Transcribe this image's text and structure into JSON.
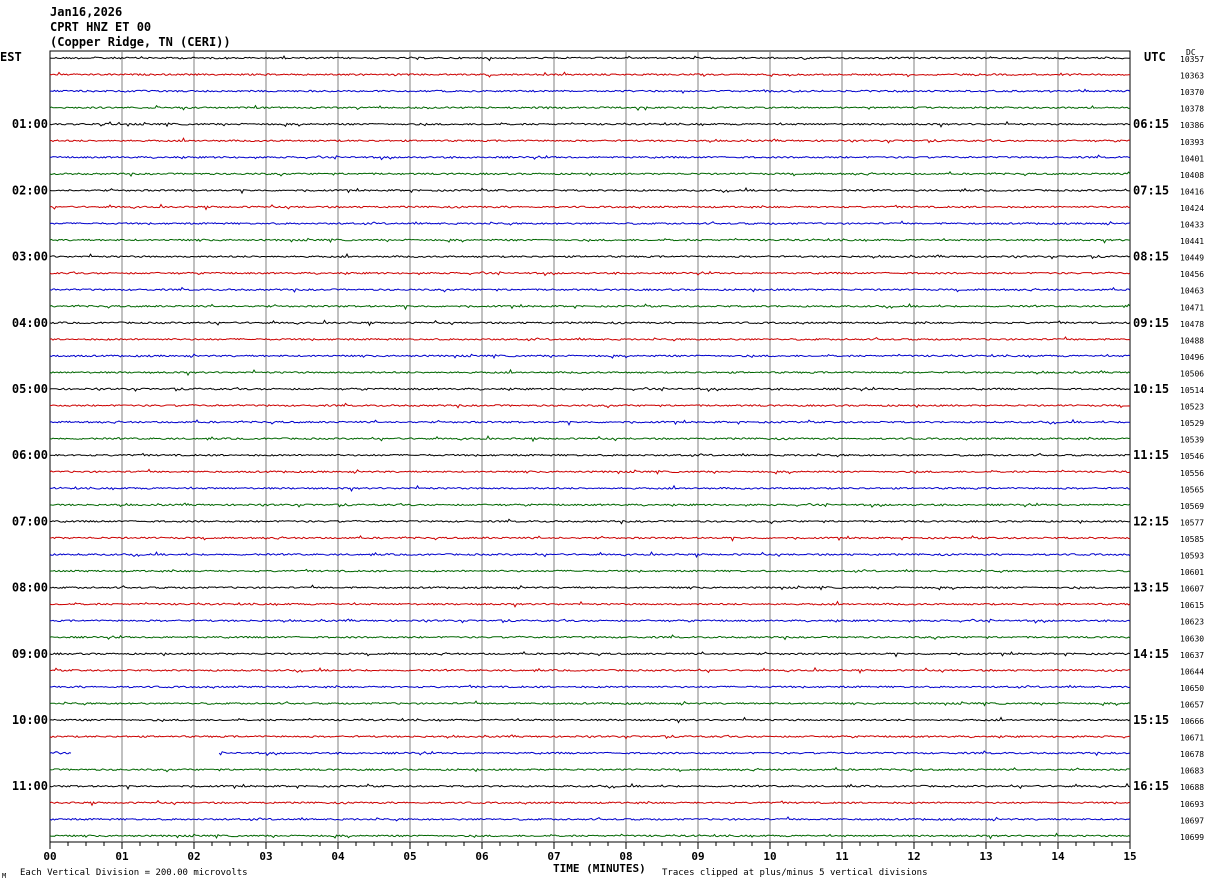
{
  "header": {
    "date": "Jan16,2026",
    "station": "CPRT HNZ ET 00",
    "location": "(Copper Ridge, TN (CERI))"
  },
  "left_timezone": "EST",
  "right_timezone": "UTC",
  "dc_label": "DC",
  "footer": {
    "scale_note": "Each Vertical Division =  200.00 microvolts",
    "clip_note": "Traces clipped at plus/minus 5 vertical divisions",
    "corner_mark": "M"
  },
  "colors": {
    "trace_cycle": [
      "#000000",
      "#cc0000",
      "#0000cc",
      "#006600"
    ],
    "grid": "#808080"
  },
  "chart_data": {
    "type": "line",
    "title": "CPRT HNZ ET 00",
    "xlabel": "TIME (MINUTES)",
    "xlim": [
      0,
      15
    ],
    "x_ticks": [
      "00",
      "01",
      "02",
      "03",
      "04",
      "05",
      "06",
      "07",
      "08",
      "09",
      "10",
      "11",
      "12",
      "13",
      "14",
      "15"
    ],
    "grid": true,
    "row_count": 48,
    "left_hour_labels": [
      "01:00",
      "02:00",
      "03:00",
      "04:00",
      "05:00",
      "06:00",
      "07:00",
      "08:00",
      "09:00",
      "10:00",
      "11:00"
    ],
    "right_hour_labels": [
      "06:15",
      "07:15",
      "08:15",
      "09:15",
      "10:15",
      "11:15",
      "12:15",
      "13:15",
      "14:15",
      "15:15",
      "16:15"
    ],
    "dc_offsets": [
      10357,
      10363,
      10370,
      10378,
      10386,
      10393,
      10401,
      10408,
      10416,
      10424,
      10433,
      10441,
      10449,
      10456,
      10463,
      10471,
      10478,
      10488,
      10496,
      10506,
      10514,
      10523,
      10529,
      10539,
      10546,
      10556,
      10565,
      10569,
      10577,
      10585,
      10593,
      10601,
      10607,
      10615,
      10623,
      10630,
      10637,
      10644,
      10650,
      10657,
      10666,
      10671,
      10678,
      10683,
      10688,
      10693,
      10697,
      10699
    ],
    "gaps": [
      {
        "row": 42,
        "from_min": 0.3,
        "to_min": 2.35
      }
    ]
  }
}
